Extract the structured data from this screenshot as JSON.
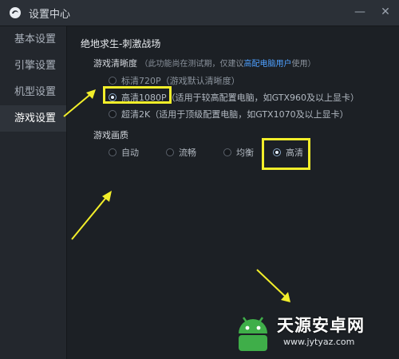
{
  "window": {
    "title": "设置中心"
  },
  "controls": {
    "minimize": "—",
    "close": "✕"
  },
  "sidebar": {
    "items": [
      {
        "label": "基本设置",
        "active": false
      },
      {
        "label": "引擎设置",
        "active": false
      },
      {
        "label": "机型设置",
        "active": false
      },
      {
        "label": "游戏设置",
        "active": true
      }
    ]
  },
  "main": {
    "game_title": "绝地求生-刺激战场",
    "resolution": {
      "label": "游戏清晰度",
      "hint_before": "（此功能尚在测试期，仅建议",
      "hint_link": "高配电脑用户",
      "hint_after": "使用）",
      "options": [
        {
          "label": "标清720P（游戏默认清晰度）",
          "checked": false,
          "enabled": true
        },
        {
          "label": "高清1080P（适用于较高配置电脑，如GTX960及以上显卡）",
          "checked": true,
          "enabled": true
        },
        {
          "label": "超清2K（适用于顶级配置电脑，如GTX1070及以上显卡）",
          "checked": false,
          "enabled": true
        }
      ]
    },
    "quality": {
      "label": "游戏画质",
      "options": [
        {
          "label": "自动",
          "checked": false
        },
        {
          "label": "流畅",
          "checked": false
        },
        {
          "label": "均衡",
          "checked": false
        },
        {
          "label": "高清",
          "checked": true
        }
      ]
    }
  },
  "watermark": {
    "name": "天源安卓网",
    "url": "www.jytyaz.com"
  },
  "colors": {
    "highlight": "#f2ee2a",
    "link": "#4ea0ff",
    "watermark_green": "#3fae49"
  }
}
